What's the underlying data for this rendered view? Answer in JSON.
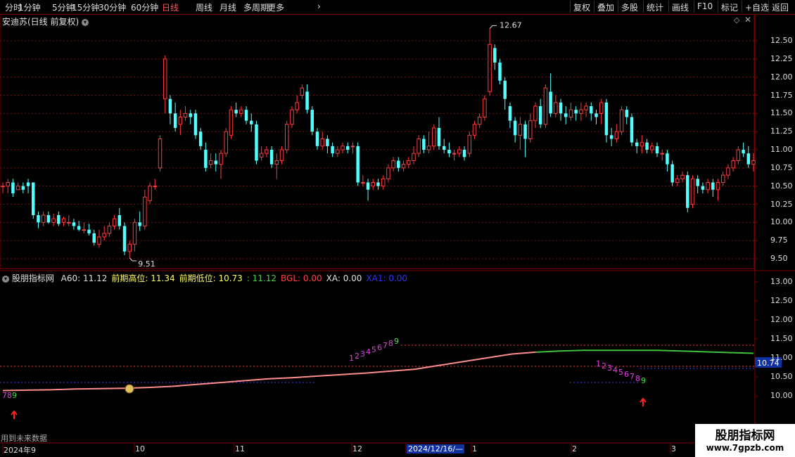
{
  "toolbar": {
    "periods": [
      "分时",
      "1分钟",
      "5分钟",
      "15分钟",
      "30分钟",
      "60分钟",
      "日线",
      "周线",
      "月线",
      "多周期",
      "更多"
    ],
    "active_period": "日线",
    "more_arrow": "›",
    "right_buttons": [
      "复权",
      "叠加",
      "多股",
      "统计",
      "画线",
      "F10",
      "标记",
      "+自选",
      "返回"
    ]
  },
  "main_pane": {
    "title": "安迪苏(日线 前复权)",
    "price_ticks": [
      "12.50",
      "12.25",
      "12.00",
      "11.75",
      "11.50",
      "11.25",
      "11.00",
      "10.75",
      "10.50",
      "10.25",
      "10.00",
      "9.75",
      "9.50"
    ],
    "high_label": "12.67",
    "low_label": "9.51"
  },
  "indicator_pane": {
    "name": "股朋指标网",
    "items": [
      {
        "label": "A60:",
        "value": "11.12",
        "color": "#e0e0e0"
      },
      {
        "label": "前期高位:",
        "value": "11.34",
        "color": "#ffff60"
      },
      {
        "label": "前期低位:",
        "value": "10.73",
        "color": "#ffff60"
      },
      {
        "label": ":",
        "value": "11.12",
        "color": "#50d050"
      },
      {
        "label": "BGL:",
        "value": "0.00",
        "color": "#ff4040"
      },
      {
        "label": "XA:",
        "value": "0.00",
        "color": "#e0e0e0"
      },
      {
        "label": "XA1:",
        "value": "0.00",
        "color": "#3030ff"
      }
    ],
    "axis_ticks": [
      "13.00",
      "12.50",
      "12.00",
      "11.50",
      "11.00",
      "10.50",
      "10.00"
    ],
    "current_value_badge": "10.74",
    "seq_left": [
      "7",
      "8",
      "9"
    ],
    "seq_mid": [
      "1",
      "2",
      "3",
      "4",
      "5",
      "6",
      "7",
      "8",
      "9"
    ],
    "seq_right": [
      "1",
      "2",
      "3",
      "4",
      "5",
      "6",
      "7",
      "8",
      "9"
    ],
    "warning_text": "用到未来数据"
  },
  "time_axis": {
    "labels": [
      "2024年9",
      "10",
      "11",
      "12",
      "2024/12/16/—",
      "1",
      "2",
      "3"
    ],
    "cursor_label": "2024/12/16/—"
  },
  "watermark": {
    "title": "股朋指标网",
    "url": "www.7gpzb.com"
  },
  "colors": {
    "up": "#ff3c3c",
    "down": "#54ffff",
    "grid": "#800000",
    "active": "#ff5050"
  },
  "chart_data": {
    "type": "candlestick",
    "candles": [
      [
        10.5,
        10.5,
        10.55,
        10.4
      ],
      [
        10.5,
        10.55,
        10.6,
        10.4
      ],
      [
        10.55,
        10.4,
        10.6,
        10.35
      ],
      [
        10.45,
        10.5,
        10.55,
        10.45
      ],
      [
        10.5,
        10.45,
        10.55,
        10.4
      ],
      [
        10.55,
        10.5,
        10.6,
        10.4
      ],
      [
        10.55,
        10.1,
        10.55,
        10.05
      ],
      [
        10.1,
        10.0,
        10.15,
        9.92
      ],
      [
        10.0,
        10.1,
        10.15,
        9.95
      ],
      [
        10.1,
        10.0,
        10.15,
        9.98
      ],
      [
        10.0,
        10.05,
        10.12,
        9.95
      ],
      [
        10.1,
        9.98,
        10.15,
        9.95
      ],
      [
        10.0,
        10.05,
        10.08,
        9.95
      ],
      [
        10.0,
        10.0,
        10.1,
        9.95
      ],
      [
        10.0,
        9.95,
        10.05,
        9.9
      ],
      [
        9.95,
        9.9,
        10.02,
        9.88
      ],
      [
        9.9,
        9.9,
        10.0,
        9.85
      ],
      [
        9.9,
        9.85,
        9.98,
        9.82
      ],
      [
        9.85,
        9.72,
        9.9,
        9.68
      ],
      [
        9.7,
        9.8,
        9.9,
        9.65
      ],
      [
        9.8,
        9.85,
        9.95,
        9.75
      ],
      [
        9.85,
        9.95,
        10.0,
        9.8
      ],
      [
        9.95,
        10.05,
        10.1,
        9.9
      ],
      [
        10.1,
        9.95,
        10.2,
        9.9
      ],
      [
        9.95,
        9.6,
        10.0,
        9.55
      ],
      [
        9.6,
        9.7,
        9.75,
        9.51
      ],
      [
        9.7,
        10.0,
        10.05,
        9.6
      ],
      [
        10.0,
        9.95,
        10.15,
        9.88
      ],
      [
        9.95,
        10.35,
        10.45,
        9.9
      ],
      [
        10.3,
        10.5,
        10.55,
        10.25
      ],
      [
        10.5,
        10.5,
        10.6,
        10.45
      ],
      [
        10.75,
        11.15,
        11.2,
        10.7
      ],
      [
        11.7,
        12.25,
        12.3,
        11.5
      ],
      [
        11.7,
        11.5,
        11.75,
        11.35
      ],
      [
        11.5,
        11.3,
        11.65,
        11.25
      ],
      [
        11.35,
        11.45,
        11.55,
        11.2
      ],
      [
        11.45,
        11.5,
        11.6,
        11.4
      ],
      [
        11.5,
        11.45,
        11.55,
        11.35
      ],
      [
        11.5,
        11.2,
        11.55,
        11.15
      ],
      [
        11.25,
        11.05,
        11.3,
        11.0
      ],
      [
        11.0,
        10.75,
        11.1,
        10.7
      ],
      [
        10.8,
        10.85,
        10.95,
        10.75
      ],
      [
        10.85,
        10.8,
        10.95,
        10.7
      ],
      [
        10.8,
        10.95,
        11.0,
        10.6
      ],
      [
        10.95,
        11.25,
        11.3,
        10.9
      ],
      [
        11.2,
        11.55,
        11.6,
        11.15
      ],
      [
        11.55,
        11.5,
        11.65,
        11.45
      ],
      [
        11.5,
        11.55,
        11.6,
        11.45
      ],
      [
        11.55,
        11.4,
        11.6,
        11.35
      ],
      [
        11.4,
        11.35,
        11.5,
        11.25
      ],
      [
        11.35,
        10.85,
        11.4,
        10.8
      ],
      [
        10.9,
        10.95,
        11.05,
        10.85
      ],
      [
        10.95,
        11.0,
        11.05,
        10.9
      ],
      [
        11.0,
        10.8,
        11.05,
        10.75
      ],
      [
        10.8,
        10.85,
        10.95,
        10.6
      ],
      [
        10.85,
        11.0,
        11.05,
        10.8
      ],
      [
        11.0,
        11.35,
        11.4,
        10.95
      ],
      [
        11.35,
        11.55,
        11.6,
        11.3
      ],
      [
        11.55,
        11.65,
        11.75,
        11.5
      ],
      [
        11.75,
        11.85,
        11.9,
        11.7
      ],
      [
        11.8,
        11.55,
        11.9,
        11.5
      ],
      [
        11.55,
        11.25,
        11.6,
        11.2
      ],
      [
        11.25,
        11.05,
        11.3,
        11.0
      ],
      [
        11.05,
        11.15,
        11.25,
        11.0
      ],
      [
        11.15,
        11.05,
        11.2,
        10.95
      ],
      [
        11.05,
        10.95,
        11.1,
        10.9
      ],
      [
        10.95,
        11.0,
        11.05,
        10.9
      ],
      [
        11.0,
        11.05,
        11.1,
        10.95
      ],
      [
        11.05,
        11.0,
        11.1,
        10.95
      ],
      [
        11.05,
        11.05,
        11.1,
        10.95
      ],
      [
        11.05,
        10.55,
        11.1,
        10.5
      ],
      [
        10.55,
        10.55,
        10.65,
        10.5
      ],
      [
        10.55,
        10.45,
        10.6,
        10.3
      ],
      [
        10.5,
        10.55,
        10.6,
        10.45
      ],
      [
        10.55,
        10.5,
        10.6,
        10.45
      ],
      [
        10.5,
        10.6,
        10.65,
        10.45
      ],
      [
        10.6,
        10.75,
        10.8,
        10.55
      ],
      [
        10.75,
        10.85,
        10.9,
        10.7
      ],
      [
        10.85,
        10.75,
        10.9,
        10.7
      ],
      [
        10.75,
        10.8,
        10.85,
        10.7
      ],
      [
        10.8,
        10.85,
        10.9,
        10.75
      ],
      [
        10.85,
        10.95,
        11.05,
        10.8
      ],
      [
        10.95,
        11.15,
        11.2,
        10.9
      ],
      [
        11.15,
        11.0,
        11.2,
        10.95
      ],
      [
        11.0,
        11.05,
        11.25,
        10.95
      ],
      [
        11.05,
        11.3,
        11.35,
        11.0
      ],
      [
        11.3,
        11.05,
        11.45,
        11.0
      ],
      [
        11.05,
        11.0,
        11.15,
        10.95
      ],
      [
        11.0,
        10.95,
        11.1,
        10.9
      ],
      [
        10.95,
        10.95,
        11.0,
        10.85
      ],
      [
        10.95,
        11.0,
        11.05,
        10.9
      ],
      [
        11.0,
        10.9,
        11.05,
        10.85
      ],
      [
        10.95,
        11.2,
        11.25,
        10.9
      ],
      [
        11.2,
        11.35,
        11.4,
        11.15
      ],
      [
        11.35,
        11.45,
        11.5,
        11.3
      ],
      [
        11.45,
        11.7,
        11.75,
        11.4
      ],
      [
        11.8,
        12.45,
        12.67,
        11.75
      ],
      [
        12.4,
        12.2,
        12.45,
        12.1
      ],
      [
        12.2,
        11.95,
        12.25,
        11.9
      ],
      [
        11.95,
        11.7,
        12.0,
        11.55
      ],
      [
        11.6,
        11.4,
        11.65,
        11.3
      ],
      [
        11.4,
        11.2,
        11.45,
        11.1
      ],
      [
        11.2,
        11.35,
        11.45,
        11.0
      ],
      [
        11.35,
        11.15,
        11.4,
        10.9
      ],
      [
        11.15,
        11.4,
        11.5,
        11.1
      ],
      [
        11.4,
        11.6,
        11.65,
        11.3
      ],
      [
        11.6,
        11.35,
        11.7,
        11.3
      ],
      [
        11.35,
        11.85,
        11.9,
        11.3
      ],
      [
        11.8,
        11.5,
        12.05,
        11.45
      ],
      [
        11.5,
        11.65,
        11.75,
        11.45
      ],
      [
        11.65,
        11.5,
        11.7,
        11.4
      ],
      [
        11.5,
        11.45,
        11.6,
        11.35
      ],
      [
        11.45,
        11.55,
        11.65,
        11.4
      ],
      [
        11.55,
        11.5,
        11.6,
        11.4
      ],
      [
        11.5,
        11.55,
        11.65,
        11.4
      ],
      [
        11.55,
        11.6,
        11.65,
        11.45
      ],
      [
        11.6,
        11.5,
        11.65,
        11.4
      ],
      [
        11.5,
        11.45,
        11.55,
        11.35
      ],
      [
        11.5,
        11.65,
        11.7,
        11.35
      ],
      [
        11.65,
        11.2,
        11.7,
        11.1
      ],
      [
        11.2,
        11.15,
        11.3,
        11.05
      ],
      [
        11.15,
        11.25,
        11.35,
        11.1
      ],
      [
        11.25,
        11.55,
        11.6,
        11.2
      ],
      [
        11.55,
        11.45,
        11.6,
        11.35
      ],
      [
        11.45,
        11.1,
        11.5,
        11.05
      ],
      [
        11.1,
        11.05,
        11.15,
        10.95
      ],
      [
        11.05,
        11.1,
        11.2,
        10.95
      ],
      [
        11.1,
        11.0,
        11.15,
        10.95
      ],
      [
        11.0,
        11.05,
        11.1,
        10.95
      ],
      [
        11.05,
        10.95,
        11.1,
        10.9
      ],
      [
        10.95,
        10.95,
        11.0,
        10.85
      ],
      [
        10.95,
        10.8,
        11.0,
        10.7
      ],
      [
        10.8,
        10.55,
        10.85,
        10.5
      ],
      [
        10.55,
        10.6,
        10.65,
        10.5
      ],
      [
        10.6,
        10.65,
        10.7,
        10.55
      ],
      [
        10.65,
        10.2,
        10.7,
        10.14
      ],
      [
        10.25,
        10.6,
        10.65,
        10.2
      ],
      [
        10.6,
        10.5,
        10.65,
        10.4
      ],
      [
        10.5,
        10.45,
        10.55,
        10.4
      ],
      [
        10.45,
        10.55,
        10.6,
        10.4
      ],
      [
        10.55,
        10.45,
        10.6,
        10.35
      ],
      [
        10.45,
        10.55,
        10.6,
        10.3
      ],
      [
        10.55,
        10.65,
        10.7,
        10.5
      ],
      [
        10.65,
        10.75,
        10.8,
        10.6
      ],
      [
        10.75,
        10.85,
        10.9,
        10.7
      ],
      [
        10.85,
        11.0,
        11.05,
        10.8
      ],
      [
        11.0,
        10.95,
        11.1,
        10.9
      ],
      [
        10.95,
        10.8,
        11.05,
        10.75
      ],
      [
        10.8,
        10.85,
        10.95,
        10.7
      ]
    ],
    "indicator_line": [
      10.14,
      10.15,
      10.16,
      10.18,
      10.19,
      10.2,
      10.22,
      10.25,
      10.3,
      10.35,
      10.4,
      10.45,
      10.48,
      10.52,
      10.56,
      10.6,
      10.65,
      10.7,
      10.8,
      10.9,
      11.0,
      11.1,
      11.15,
      11.18,
      11.2,
      11.2,
      11.2,
      11.2,
      11.18,
      11.16,
      11.14,
      11.12
    ]
  }
}
